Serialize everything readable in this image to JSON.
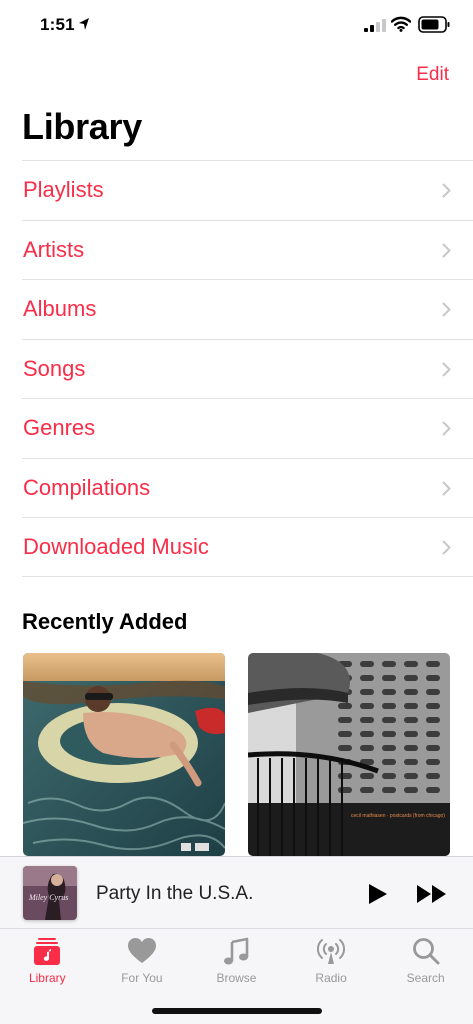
{
  "status": {
    "time": "1:51"
  },
  "header": {
    "edit_label": "Edit",
    "title": "Library"
  },
  "menu": {
    "items": [
      {
        "label": "Playlists"
      },
      {
        "label": "Artists"
      },
      {
        "label": "Albums"
      },
      {
        "label": "Songs"
      },
      {
        "label": "Genres"
      },
      {
        "label": "Compilations"
      },
      {
        "label": "Downloaded Music"
      }
    ]
  },
  "recently_added": {
    "title": "Recently Added",
    "albums": [
      {
        "art": "pool-float-cover"
      },
      {
        "art": "apartment-towers-cover",
        "caption": "cecil mathiasen · postcards (from chicago)"
      }
    ]
  },
  "now_playing": {
    "title": "Party In the U.S.A.",
    "art_text": "Miley Cyrus"
  },
  "tabs": [
    {
      "label": "Library",
      "icon": "library-icon",
      "active": true
    },
    {
      "label": "For You",
      "icon": "heart-icon",
      "active": false
    },
    {
      "label": "Browse",
      "icon": "music-note-icon",
      "active": false
    },
    {
      "label": "Radio",
      "icon": "radio-icon",
      "active": false
    },
    {
      "label": "Search",
      "icon": "search-icon",
      "active": false
    }
  ],
  "colors": {
    "accent": "#fa2d48",
    "inactive_tab": "#999999",
    "separator": "#e2e2e6"
  }
}
